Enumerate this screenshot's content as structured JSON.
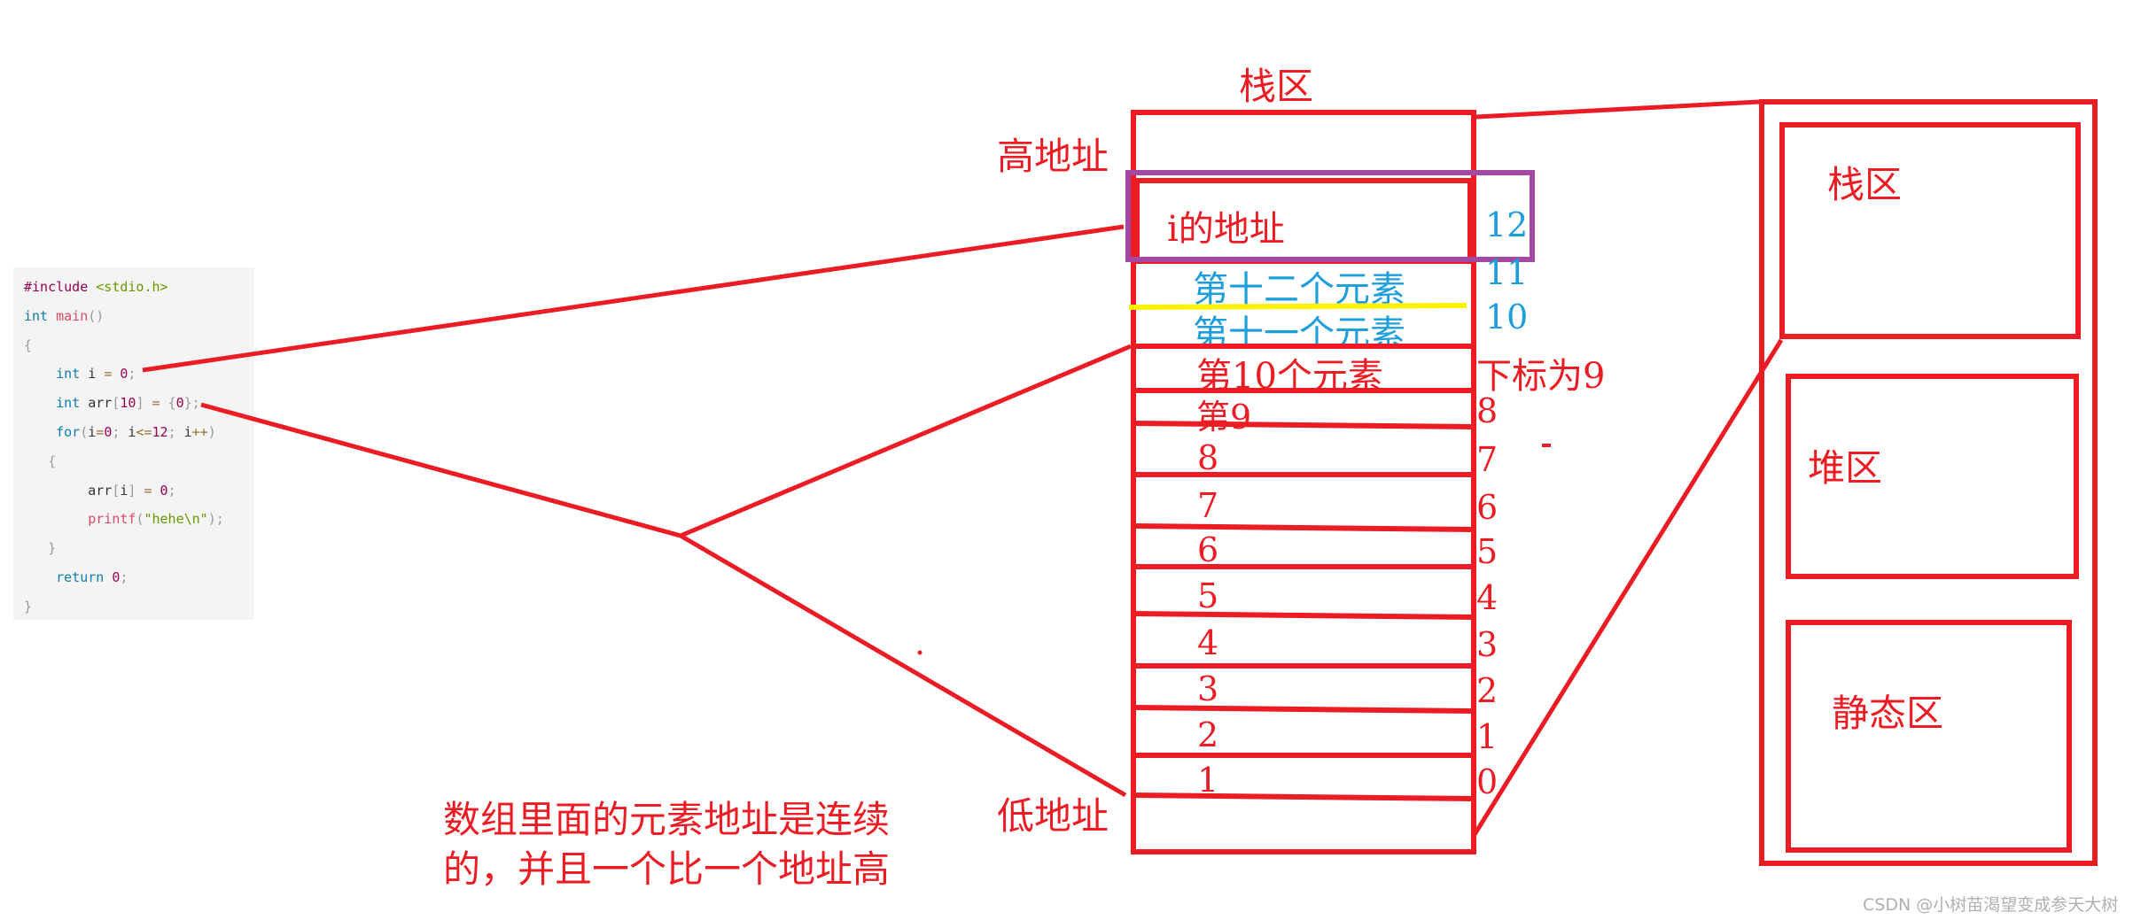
{
  "code": {
    "lines": [
      {
        "tokens": [
          {
            "t": "#include",
            "c": "pre"
          },
          {
            "t": " <stdio.h>",
            "c": "str"
          }
        ]
      },
      {
        "tokens": [
          {
            "t": "int",
            "c": "kw"
          },
          {
            "t": " ",
            "c": ""
          },
          {
            "t": "main",
            "c": "fn"
          },
          {
            "t": "()",
            "c": "punc"
          }
        ]
      },
      {
        "tokens": [
          {
            "t": "{",
            "c": "punc"
          }
        ]
      },
      {
        "tokens": [
          {
            "t": "    int",
            "c": "kw"
          },
          {
            "t": " i ",
            "c": ""
          },
          {
            "t": "=",
            "c": "op"
          },
          {
            "t": " ",
            "c": ""
          },
          {
            "t": "0",
            "c": "num"
          },
          {
            "t": ";",
            "c": "punc"
          }
        ]
      },
      {
        "tokens": [
          {
            "t": "    int",
            "c": "kw"
          },
          {
            "t": " arr",
            "c": ""
          },
          {
            "t": "[",
            "c": "punc"
          },
          {
            "t": "10",
            "c": "num"
          },
          {
            "t": "]",
            "c": "punc"
          },
          {
            "t": " = ",
            "c": "op"
          },
          {
            "t": "{",
            "c": "punc"
          },
          {
            "t": "0",
            "c": "num"
          },
          {
            "t": "};",
            "c": "punc"
          }
        ]
      },
      {
        "tokens": [
          {
            "t": "    for",
            "c": "kw"
          },
          {
            "t": "(",
            "c": "punc"
          },
          {
            "t": "i",
            "c": ""
          },
          {
            "t": "=",
            "c": "op"
          },
          {
            "t": "0",
            "c": "num"
          },
          {
            "t": "; ",
            "c": "punc"
          },
          {
            "t": "i",
            "c": ""
          },
          {
            "t": "<=",
            "c": "op"
          },
          {
            "t": "12",
            "c": "num"
          },
          {
            "t": "; ",
            "c": "punc"
          },
          {
            "t": "i",
            "c": ""
          },
          {
            "t": "++",
            "c": "op"
          },
          {
            "t": ")",
            "c": "punc"
          }
        ]
      },
      {
        "tokens": [
          {
            "t": "   {",
            "c": "punc"
          }
        ]
      },
      {
        "tokens": [
          {
            "t": "        arr",
            "c": ""
          },
          {
            "t": "[",
            "c": "punc"
          },
          {
            "t": "i",
            "c": ""
          },
          {
            "t": "]",
            "c": "punc"
          },
          {
            "t": " = ",
            "c": "op"
          },
          {
            "t": "0",
            "c": "num"
          },
          {
            "t": ";",
            "c": "punc"
          }
        ]
      },
      {
        "tokens": [
          {
            "t": "        printf",
            "c": "fn"
          },
          {
            "t": "(",
            "c": "punc"
          },
          {
            "t": "\"hehe\\n\"",
            "c": "str"
          },
          {
            "t": ");",
            "c": "punc"
          }
        ]
      },
      {
        "tokens": [
          {
            "t": "   }",
            "c": "punc"
          }
        ]
      },
      {
        "tokens": [
          {
            "t": "    return",
            "c": "kw"
          },
          {
            "t": " ",
            "c": ""
          },
          {
            "t": "0",
            "c": "num"
          },
          {
            "t": ";",
            "c": "punc"
          }
        ]
      },
      {
        "tokens": [
          {
            "t": "}",
            "c": "punc"
          }
        ]
      }
    ]
  },
  "stack": {
    "title": "栈区",
    "high_address": "高地址",
    "low_address": "低地址",
    "i_address_label": "i的地址",
    "overflow_elements": [
      {
        "label": "第十二个元素",
        "index": "11"
      },
      {
        "label": "第十一个元素",
        "index": "10"
      }
    ],
    "i_index": "12",
    "elements": [
      {
        "label": "第10个元素",
        "index": "下标为9"
      },
      {
        "label": "第9",
        "index": "8"
      },
      {
        "label": "8",
        "index": "7"
      },
      {
        "label": "7",
        "index": "6"
      },
      {
        "label": "6",
        "index": "5"
      },
      {
        "label": "5",
        "index": "4"
      },
      {
        "label": "4",
        "index": "3"
      },
      {
        "label": "3",
        "index": "2"
      },
      {
        "label": "2",
        "index": "1"
      },
      {
        "label": "1",
        "index": "0"
      }
    ]
  },
  "memory": {
    "regions": [
      "栈区",
      "堆区",
      "静态区"
    ]
  },
  "caption": {
    "line1": "数组里面的元素地址是连续",
    "line2": "的，并且一个比一个地址高"
  },
  "watermark": "CSDN @小树苗渴望变成参天大树",
  "colors": {
    "red": "#ec1c24",
    "blue": "#1e9fdc",
    "purple": "#a349a4",
    "yellow": "#fff200"
  }
}
